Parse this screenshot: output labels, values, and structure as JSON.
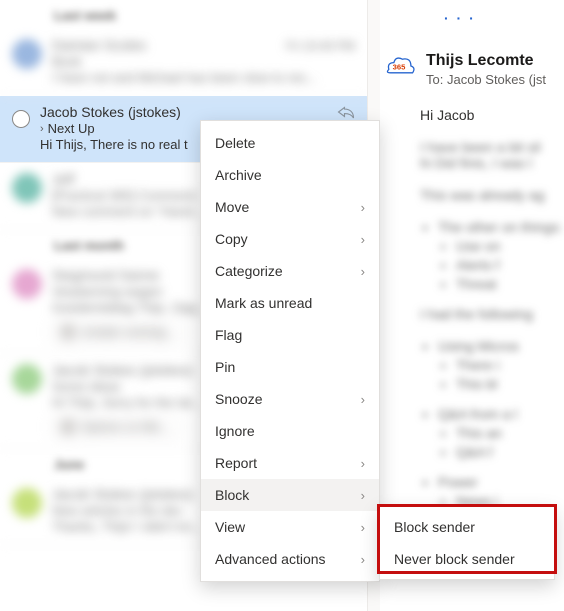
{
  "groups": {
    "last_week": "Last week",
    "last_month": "Last month",
    "june": "June"
  },
  "messages": {
    "m0": {
      "sender": "Damian Scoles",
      "time": "Fri 10:40 PM",
      "subject": "Book",
      "preview": "I have not and Michael has been slow to res..."
    },
    "selected": {
      "sender": "Jacob Stokes (jstokes)",
      "subject": "Next Up",
      "preview": "Hi Thijs, There is no real t"
    },
    "m2": {
      "sender": "Jeff",
      "subject": "[Practical 365] Comment:",
      "preview": "New comment on \"Hand..."
    },
    "m3": {
      "sender": "Siegmund Sanne",
      "subject": "Verplanning wagen",
      "preview": "Goedemiddag Thijs, Opg...",
      "attachment": "schade voertuig..."
    },
    "m4": {
      "sender": "Jacob Stokes (jstokes)",
      "subject": "Some ideas",
      "preview": "Hi Thijs, Sorry for the lat...",
      "attachment": "Opinion on Mic..."
    },
    "m5": {
      "sender": "Jacob Stokes (jstokes)",
      "subject": "New articles in the dev",
      "preview": "Thanks, Thijs! I didn't kn..."
    }
  },
  "context_menu": {
    "delete": "Delete",
    "archive": "Archive",
    "move": "Move",
    "copy": "Copy",
    "categorize": "Categorize",
    "mark_unread": "Mark as unread",
    "flag": "Flag",
    "pin": "Pin",
    "snooze": "Snooze",
    "ignore": "Ignore",
    "report": "Report",
    "block": "Block",
    "view": "View",
    "advanced": "Advanced actions"
  },
  "block_submenu": {
    "block_sender": "Block sender",
    "never_block": "Never block sender"
  },
  "reading": {
    "ellipsis": "· · ·",
    "from": "Thijs Lecomte",
    "to_label": "To:",
    "to_value": "Jacob Stokes (jst",
    "greeting": "Hi Jacob",
    "para1": "I have been a bit sil",
    "para1b": "hi Did finis, I was l",
    "para2": "This was already ag",
    "bullet1": "The other on",
    "bullet1b": "things:",
    "sub1": "Use on",
    "sub2": "Alerts f",
    "sub3": "Threat",
    "para3": "I had the following",
    "bullet2": "Using Micros",
    "sub4": "There i",
    "sub5": "This bl",
    "bullet3": "Q&A from a l",
    "sub6": "This an",
    "sub7": "Q&A f",
    "bullet4": "Power",
    "sub8": "News i"
  }
}
